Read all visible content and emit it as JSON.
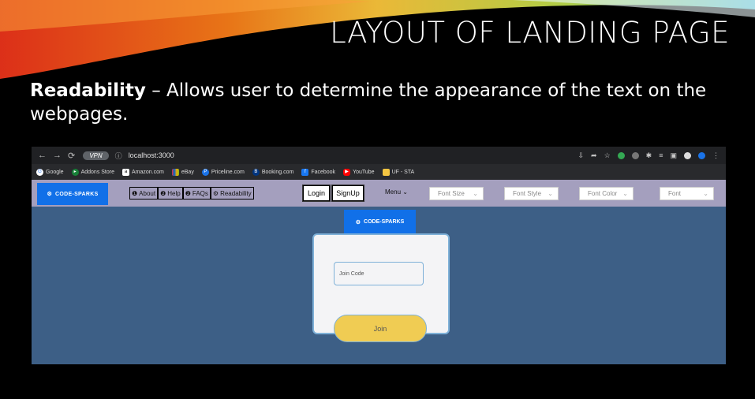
{
  "slide": {
    "title": "LAYOUT OF LANDING PAGE",
    "body_bold": "Readability",
    "body_rest": " – Allows user to determine the appearance of the text on the webpages."
  },
  "browser": {
    "vpn_label": "VPN",
    "url": "localhost:3000",
    "bookmarks": [
      {
        "label": "Google",
        "icon": "google-icon",
        "color": "#4285f4"
      },
      {
        "label": "Addons Store",
        "icon": "addons-icon",
        "color": "#188038"
      },
      {
        "label": "Amazon.com",
        "icon": "amazon-icon",
        "color": "#ffffff"
      },
      {
        "label": "eBay",
        "icon": "ebay-icon",
        "color": "#e53238"
      },
      {
        "label": "Priceline.com",
        "icon": "priceline-icon",
        "color": "#1a73e8"
      },
      {
        "label": "Booking.com",
        "icon": "booking-icon",
        "color": "#003580"
      },
      {
        "label": "Facebook",
        "icon": "facebook-icon",
        "color": "#1877f2"
      },
      {
        "label": "YouTube",
        "icon": "youtube-icon",
        "color": "#ff0000"
      },
      {
        "label": "UF - STA",
        "icon": "folder-icon",
        "color": "#f4c542"
      }
    ]
  },
  "app": {
    "logo": "CODE-SPARKS",
    "nav": [
      "About",
      "Help",
      "FAQs",
      "Readability"
    ],
    "login": "Login",
    "signup": "SignUp",
    "menu": "Menu",
    "selects": [
      "Font Size",
      "Font Style",
      "Font Color",
      "Font"
    ],
    "join_placeholder": "Join Code",
    "join_button": "Join"
  },
  "colors": {
    "page_bg": "#3d5f86",
    "navbar": "#a49fbe",
    "brand": "#1170e8",
    "join_button": "#f0cc53"
  }
}
